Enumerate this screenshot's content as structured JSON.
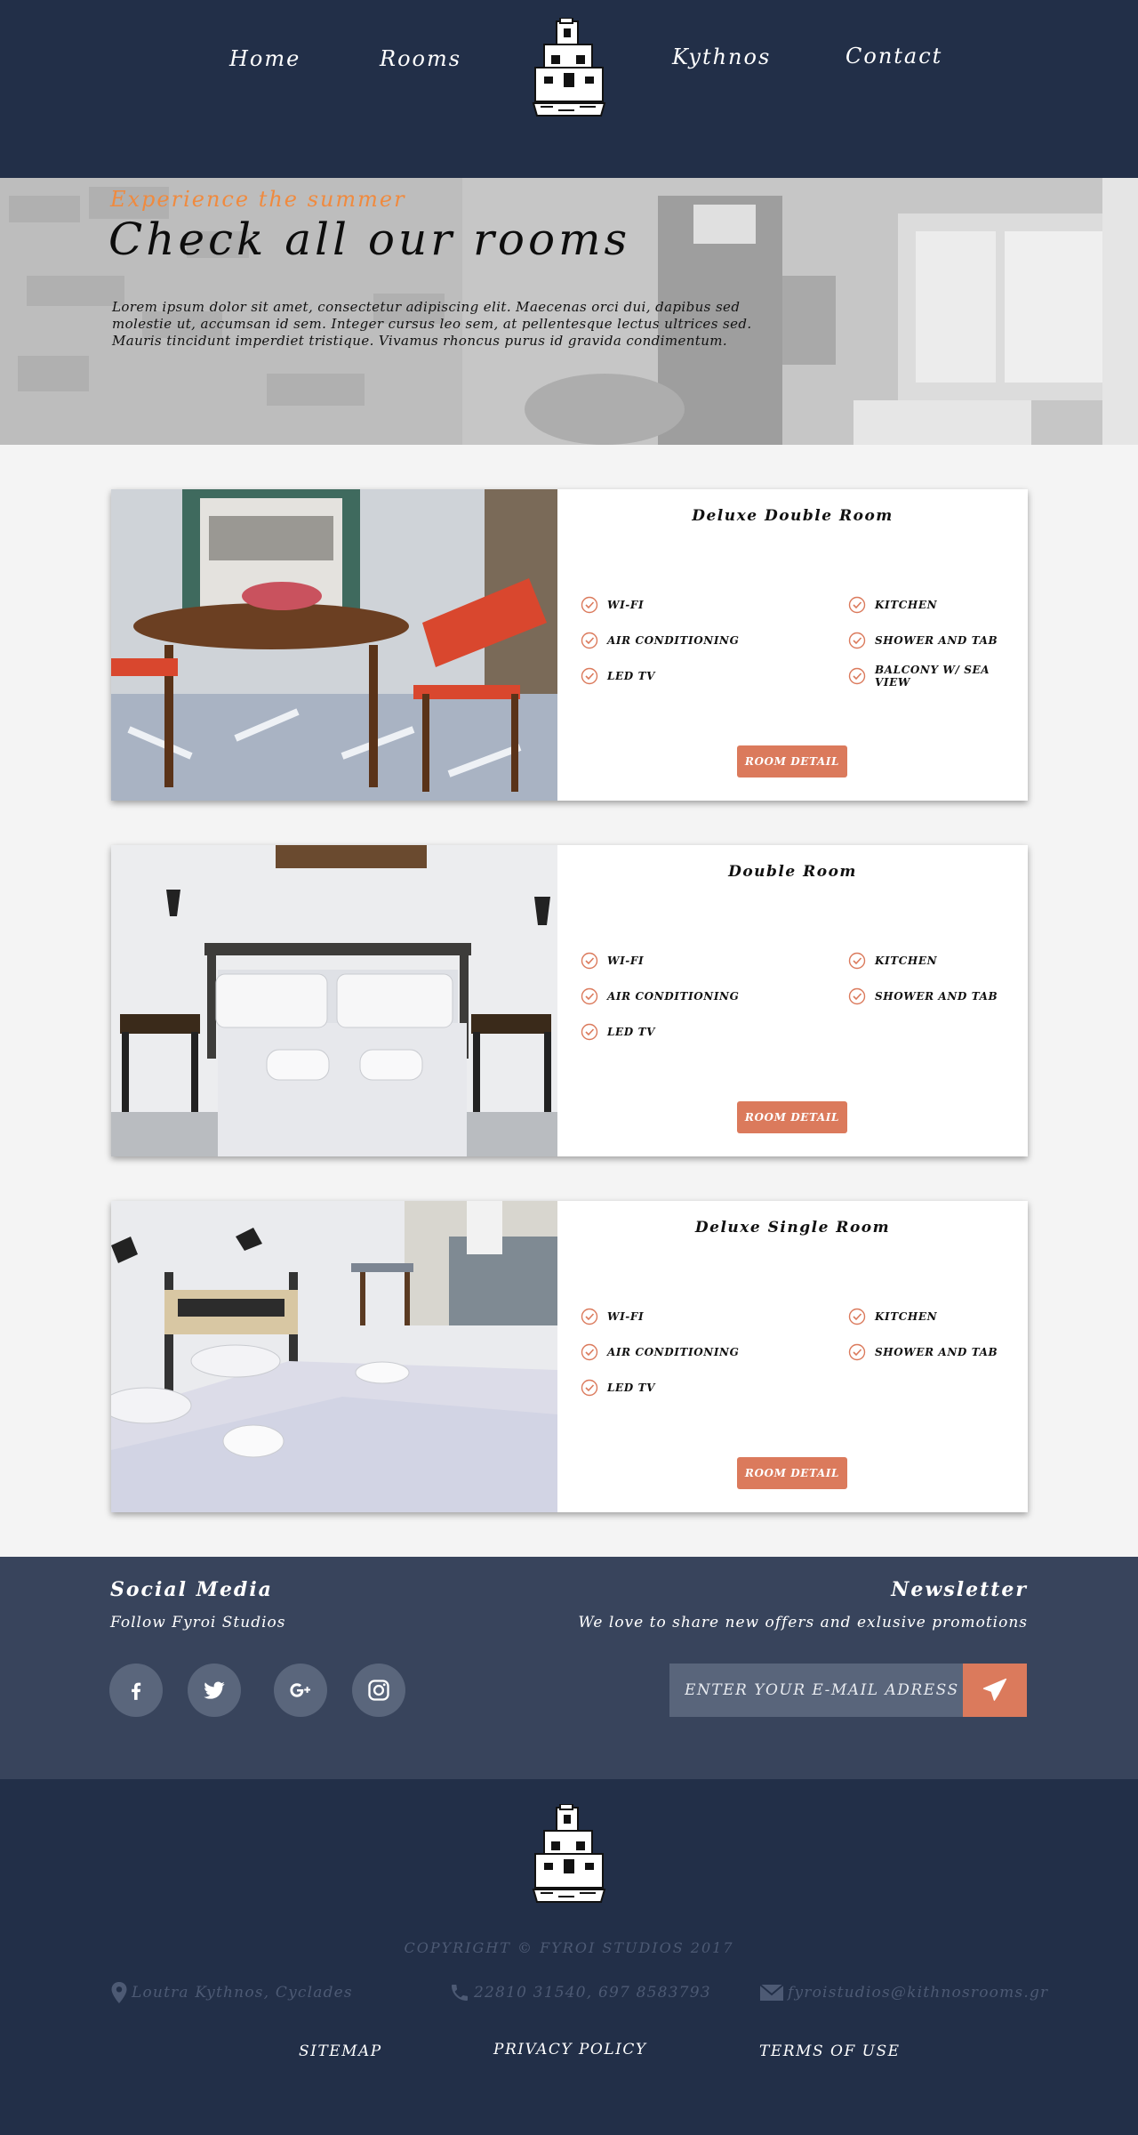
{
  "nav": {
    "home": "Home",
    "rooms": "Rooms",
    "kythnos": "Kythnos",
    "contact": "Contact"
  },
  "hero": {
    "tagline": "Experience the summer",
    "title": "Check all our rooms",
    "text": "Lorem ipsum dolor sit amet, consectetur adipiscing elit. Maecenas orci dui, dapibus sed molestie ut, accumsan id sem. Integer cursus leo sem, at pellentesque lectus ultrices sed. Mauris tincidunt imperdiet tristique. Vivamus rhoncus purus id gravida condimentum."
  },
  "rooms": [
    {
      "title": "Deluxe Double Room",
      "amenities_left": [
        "WI-FI",
        "AIR CONDITIONING",
        "LED TV"
      ],
      "amenities_right": [
        "KITCHEN",
        "SHOWER AND TAB",
        "BALCONY W/ SEA VIEW"
      ],
      "button": "ROOM DETAIL"
    },
    {
      "title": "Double Room",
      "amenities_left": [
        "WI-FI",
        "AIR CONDITIONING",
        "LED TV"
      ],
      "amenities_right": [
        "KITCHEN",
        "SHOWER AND TAB"
      ],
      "button": "ROOM DETAIL"
    },
    {
      "title": "Deluxe Single Room",
      "amenities_left": [
        "WI-FI",
        "AIR CONDITIONING",
        "LED TV"
      ],
      "amenities_right": [
        "KITCHEN",
        "SHOWER AND TAB"
      ],
      "button": "ROOM DETAIL"
    }
  ],
  "social": {
    "title": "Social Media",
    "subtitle": "Follow Fyroi Studios",
    "icons": [
      "facebook-icon",
      "twitter-icon",
      "google-plus-icon",
      "instagram-icon"
    ]
  },
  "newsletter": {
    "title": "Newsletter",
    "subtitle": "We love to share new offers and exlusive promotions",
    "placeholder": "ENTER YOUR E-MAIL ADRESS"
  },
  "footer": {
    "copyright": "COPYRIGHT © FYROI STUDIOS 2017",
    "address": "Loutra Kythnos, Cyclades",
    "phone": "22810 31540, 697 8583793",
    "email": "fyroistudios@kithnosrooms.gr",
    "links": [
      "SITEMAP",
      "PRIVACY POLICY",
      "TERMS OF USE"
    ]
  },
  "colors": {
    "navy": "#222f48",
    "slate": "#38445c",
    "accent": "#db7a5c",
    "tagline": "#f08a3e"
  }
}
